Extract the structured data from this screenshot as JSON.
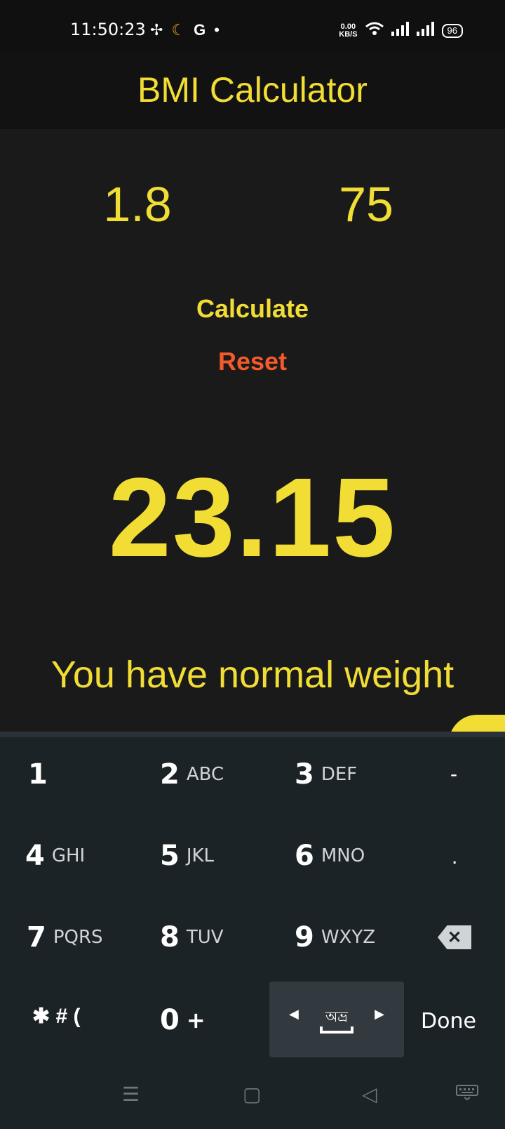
{
  "status_bar": {
    "time": "11:50:23",
    "net_speed_value": "0.00",
    "net_speed_unit": "KB/S",
    "battery": "96"
  },
  "app": {
    "title": "BMI Calculator",
    "height_value": "1.8",
    "weight_value": "75",
    "calculate_label": "Calculate",
    "reset_label": "Reset",
    "bmi_value": "23.15",
    "bmi_message": "You have normal weight"
  },
  "keyboard": {
    "keys": [
      {
        "num": "1",
        "letters": ""
      },
      {
        "num": "2",
        "letters": "ABC"
      },
      {
        "num": "3",
        "letters": "DEF"
      },
      {
        "num": "4",
        "letters": "GHI"
      },
      {
        "num": "5",
        "letters": "JKL"
      },
      {
        "num": "6",
        "letters": "MNO"
      },
      {
        "num": "7",
        "letters": "PQRS"
      },
      {
        "num": "8",
        "letters": "TUV"
      },
      {
        "num": "9",
        "letters": "WXYZ"
      },
      {
        "num": "0",
        "letters": "+"
      }
    ],
    "dash": "-",
    "dot": ".",
    "symbols": "✱ # (",
    "language": "অভ্র",
    "done_label": "Done"
  },
  "colors": {
    "accent": "#f2dd35",
    "reset": "#f45a2a",
    "background": "#1a1a1a",
    "keyboard": "#1c2327"
  }
}
